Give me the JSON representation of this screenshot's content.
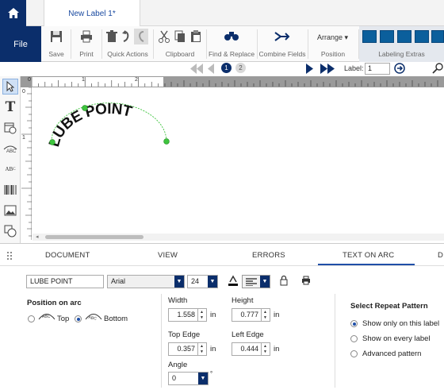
{
  "tab": {
    "title": "New Label 1*"
  },
  "ribbon": {
    "file": "File",
    "save": "Save",
    "print": "Print",
    "quick_actions": "Quick Actions",
    "clipboard": "Clipboard",
    "find_replace": "Find & Replace",
    "combine_fields": "Combine Fields",
    "arrange": "Arrange",
    "position": "Position",
    "labeling_extras": "Labeling Extras"
  },
  "nav": {
    "page1": "1",
    "page2": "2",
    "label_caption": "Label:",
    "label_value": "1"
  },
  "ruler": {
    "ticks": [
      "0",
      "1",
      "2"
    ],
    "v_ticks": [
      "0",
      "1"
    ]
  },
  "canvas": {
    "arc_text": "LUBE POINT"
  },
  "bottom_tabs": [
    "DOCUMENT",
    "VIEW",
    "ERRORS",
    "TEXT ON ARC",
    "D"
  ],
  "props": {
    "text_value": "LUBE POINT",
    "font": "Arial",
    "size": "24",
    "position_on_arc": "Position on arc",
    "top": "Top",
    "bottom": "Bottom",
    "width_label": "Width",
    "width_value": "1.558",
    "height_label": "Height",
    "height_value": "0.777",
    "top_edge_label": "Top Edge",
    "top_edge_value": "0.357",
    "left_edge_label": "Left Edge",
    "left_edge_value": "0.444",
    "angle_label": "Angle",
    "angle_value": "0",
    "unit": "in",
    "degree": "°",
    "repeat_title": "Select Repeat Pattern",
    "repeat_options": [
      "Show only on this label",
      "Show on every label",
      "Advanced pattern"
    ]
  },
  "colors": {
    "brand": "#0b2e6b",
    "accent": "#1f4fa8"
  }
}
